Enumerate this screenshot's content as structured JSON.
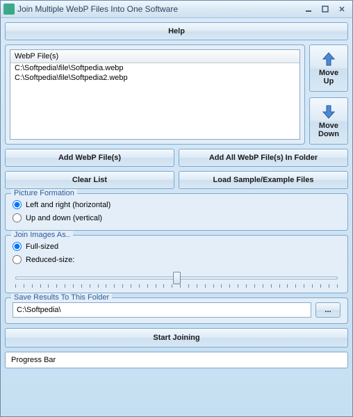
{
  "titlebar": {
    "title": "Join Multiple WebP Files Into One Software"
  },
  "help_button": "Help",
  "file_list": {
    "header": "WebP File(s)",
    "items": [
      "C:\\Softpedia\\file\\Softpedia.webp",
      "C:\\Softpedia\\file\\Softpedia2.webp"
    ]
  },
  "move_up_label": "Move\nUp",
  "move_down_label": "Move\nDown",
  "buttons": {
    "add_files": "Add WebP File(s)",
    "add_folder": "Add All WebP File(s) In Folder",
    "clear_list": "Clear List",
    "load_sample": "Load Sample/Example Files"
  },
  "picture_formation": {
    "legend": "Picture Formation",
    "horizontal": "Left and right (horizontal)",
    "vertical": "Up and down (vertical)"
  },
  "join_images": {
    "legend": "Join Images As..",
    "full_sized": "Full-sized",
    "reduced_size": "Reduced-size:"
  },
  "save_results": {
    "legend": "Save Results To This Folder",
    "path": "C:\\Softpedia\\",
    "browse": "..."
  },
  "start_button": "Start Joining",
  "progress_label": "Progress Bar"
}
